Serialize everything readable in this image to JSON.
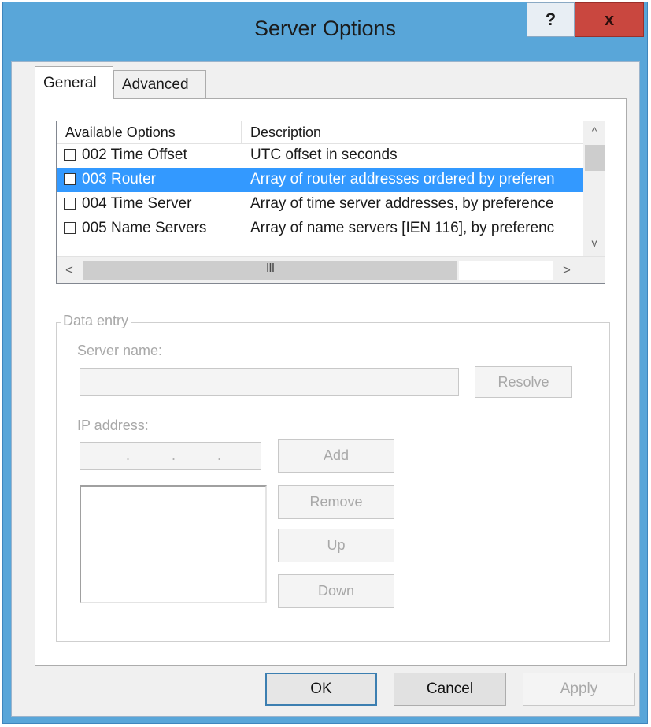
{
  "window": {
    "title": "Server Options",
    "help_label": "?",
    "close_label": "x"
  },
  "tabs": [
    {
      "label": "General",
      "selected": true
    },
    {
      "label": "Advanced",
      "selected": false
    }
  ],
  "options_list": {
    "headers": {
      "name": "Available Options",
      "description": "Description"
    },
    "rows": [
      {
        "name": "002 Time Offset",
        "description": "UTC offset in seconds",
        "checked": false,
        "selected": false
      },
      {
        "name": "003 Router",
        "description": "Array of router addresses ordered by preferen",
        "checked": false,
        "selected": true
      },
      {
        "name": "004 Time Server",
        "description": "Array of time server addresses, by preference",
        "checked": false,
        "selected": false
      },
      {
        "name": "005 Name Servers",
        "description": "Array of name servers [IEN 116], by preferenc",
        "checked": false,
        "selected": false
      }
    ],
    "scroll": {
      "left": "<",
      "right": ">",
      "up": "^",
      "down": "v",
      "grip": "III"
    }
  },
  "data_entry": {
    "legend": "Data entry",
    "server_name_label": "Server name:",
    "server_name_value": "",
    "resolve_label": "Resolve",
    "ip_address_label": "IP address:",
    "ip_separator": ".",
    "add_label": "Add",
    "remove_label": "Remove",
    "up_label": "Up",
    "down_label": "Down"
  },
  "footer": {
    "ok_label": "OK",
    "cancel_label": "Cancel",
    "apply_label": "Apply"
  },
  "colors": {
    "window_frame": "#59a6d9",
    "selection": "#3399ff",
    "close_button": "#c9473f"
  }
}
